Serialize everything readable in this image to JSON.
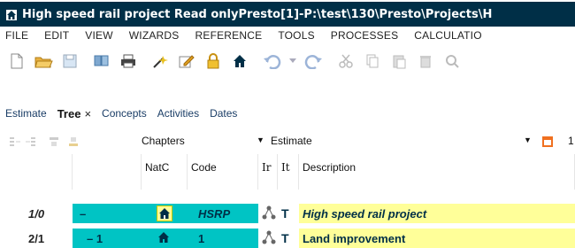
{
  "window": {
    "title": "High speed rail project Read onlyPresto[1]-P:\\test\\130\\Presto\\Projects\\H"
  },
  "menu": [
    "FILE",
    "EDIT",
    "VIEW",
    "WIZARDS",
    "REFERENCE",
    "TOOLS",
    "PROCESSES",
    "CALCULATIO"
  ],
  "toolbar": {
    "icons": [
      "new-document-icon",
      "open-folder-icon",
      "save-icon",
      "copy-window-icon",
      "print-icon",
      "wizard-icon",
      "edit-document-icon",
      "lock-icon",
      "house-icon",
      "undo-icon",
      "dropdown-arrow-icon",
      "redo-icon",
      "cut-icon",
      "copy-icon",
      "paste-icon",
      "delete-icon",
      "search-icon"
    ]
  },
  "tabs": [
    {
      "label": "Estimate"
    },
    {
      "label": "Tree",
      "active": true,
      "close": "×"
    },
    {
      "label": "Concepts"
    },
    {
      "label": "Activities"
    },
    {
      "label": "Dates"
    }
  ],
  "filterbar": {
    "chapters": "Chapters",
    "estimate": "Estimate",
    "right_fragment": "1"
  },
  "columns": {
    "natc": "NatC",
    "code": "Code",
    "ir": "Ir",
    "it": "It",
    "description": "Description"
  },
  "rows": [
    {
      "number": "1/0",
      "level": "–",
      "natc_icon": "house-icon",
      "code": "HSRP",
      "it": "T",
      "description": "High speed rail project"
    },
    {
      "number": "2/1",
      "level": "– 1",
      "natc_icon": "house-icon",
      "code": "1",
      "it": "T",
      "description": "Land improvement"
    }
  ],
  "colors": {
    "title_bg": "#002F47",
    "level_bg": "#00C4C4",
    "desc_bg": "#FFFF99",
    "dark_blue": "#002F47"
  }
}
